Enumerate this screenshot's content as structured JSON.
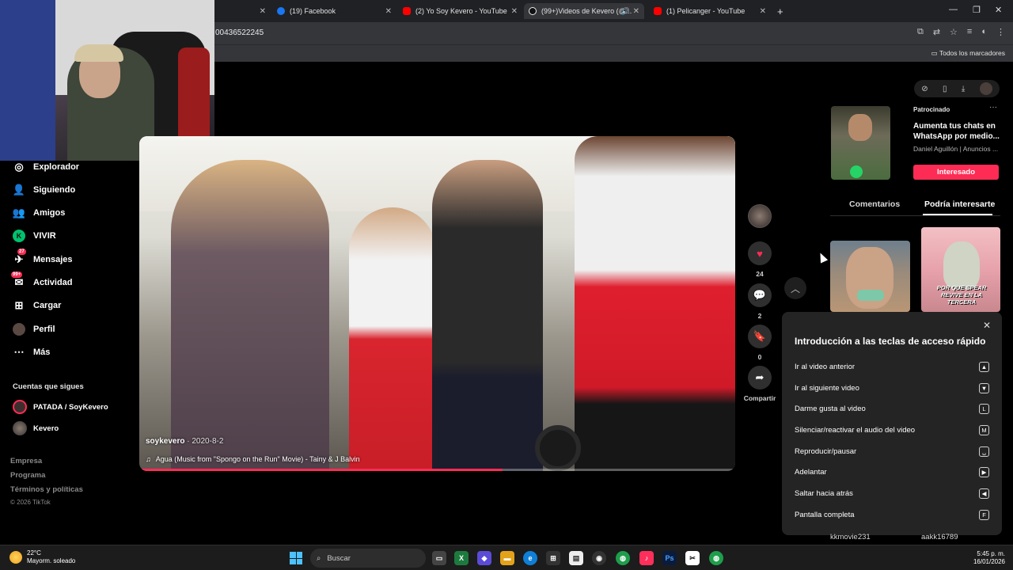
{
  "browser": {
    "tabs": [
      {
        "label": "",
        "favicon_color": "#202124"
      },
      {
        "label": "(19) Facebook",
        "favicon_color": "#1877f2"
      },
      {
        "label": "(2) Yo Soy Kevero - YouTube",
        "favicon_color": "#ff0000"
      },
      {
        "label": "(99+)Videos de Kevero (@...",
        "favicon_color": "#111111",
        "active": true
      },
      {
        "label": "(1) Pelicanger - YouTube",
        "favicon_color": "#ff0000"
      }
    ],
    "new_tab": "+",
    "url": "00436522245",
    "bookmarks_label": "Todos los marcadores"
  },
  "sidebar": {
    "items": [
      {
        "label": "Explorador",
        "icon": "compass-icon"
      },
      {
        "label": "Siguiendo",
        "icon": "following-icon"
      },
      {
        "label": "Amigos",
        "icon": "friends-icon"
      },
      {
        "label": "VIVIR",
        "icon": "live-icon"
      },
      {
        "label": "Mensajes",
        "icon": "messages-icon",
        "badge": "27"
      },
      {
        "label": "Actividad",
        "icon": "activity-icon",
        "badge": "99+"
      },
      {
        "label": "Cargar",
        "icon": "upload-icon"
      },
      {
        "label": "Perfil",
        "icon": "profile-icon"
      },
      {
        "label": "Más",
        "icon": "more-icon"
      }
    ],
    "following_title": "Cuentas que sigues",
    "following": [
      {
        "label": "PATADA / SoyKevero"
      },
      {
        "label": "Kevero"
      }
    ],
    "footer": [
      "Empresa",
      "Programa",
      "Términos y políticas"
    ],
    "copyright": "© 2026 TikTok"
  },
  "video": {
    "author": "soykevero",
    "date": " · 2020-8-2",
    "music": "Agua (Music from \"Spongo on the Run\" Movie) - Tainy & J Balvin",
    "progress": 0.61
  },
  "actions": {
    "likes": "24",
    "comments": "2",
    "saves": "0",
    "share_label": "Compartir"
  },
  "ad": {
    "label": "Patrocinado",
    "title": "Aumenta tus chats en WhatsApp por medio...",
    "sub": "Daniel Aguillón | Anuncios ...",
    "button": "Interesado",
    "more": "···"
  },
  "panel_tabs": {
    "comments": "Comentarios",
    "suggested": "Podría interesarte"
  },
  "suggested": {
    "thumb2_caption": "POR QUE SPEAR REVIVE EN LA TERCERA",
    "user1": "kkmovie231",
    "user2": "aakk16789"
  },
  "shortcuts": {
    "title": "Introducción a las teclas de acceso rápido",
    "close": "✕",
    "rows": [
      {
        "label": "Ir al video anterior",
        "key": "▲"
      },
      {
        "label": "Ir al siguiente video",
        "key": "▼"
      },
      {
        "label": "Darme gusta al video",
        "key": "L"
      },
      {
        "label": "Silenciar/reactivar el audio del video",
        "key": "M"
      },
      {
        "label": "Reproducir/pausar",
        "key": "␣"
      },
      {
        "label": "Adelantar",
        "key": "▶"
      },
      {
        "label": "Saltar hacia atrás",
        "key": "◀"
      },
      {
        "label": "Pantalla completa",
        "key": "F"
      }
    ]
  },
  "taskbar": {
    "temp": "22°C",
    "weather": "Mayorm. soleado",
    "search": "Buscar",
    "time": "5:45 p. m.",
    "date": "16/01/2026"
  }
}
